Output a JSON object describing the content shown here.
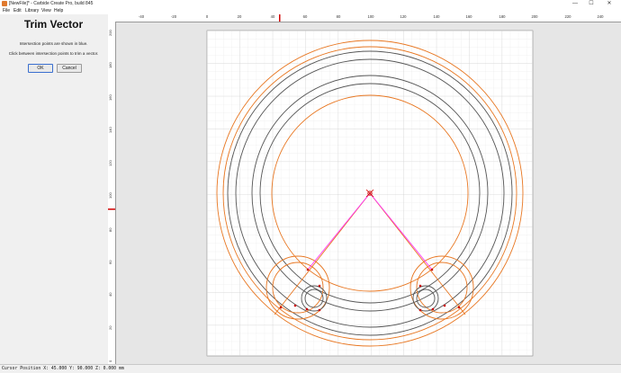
{
  "window": {
    "title": "[NewFile]* - Carbide Create Pro, build 845",
    "minimize_glyph": "—",
    "maximize_glyph": "☐",
    "close_glyph": "✕"
  },
  "menu": {
    "items": [
      "File",
      "Edit",
      "Library",
      "View",
      "Help"
    ]
  },
  "panel": {
    "title": "Trim Vector",
    "line1": "Intersection points are shown in blue.",
    "line2": "Click between intersection points to trim a vector.",
    "ok_label": "OK",
    "cancel_label": "Cancel"
  },
  "ruler": {
    "top_labels": [
      "-40",
      "-20",
      "0",
      "20",
      "40",
      "60",
      "80",
      "100",
      "120",
      "140",
      "160",
      "180",
      "200",
      "220",
      "240"
    ],
    "left_labels": [
      "200",
      "180",
      "160",
      "140",
      "120",
      "100",
      "80",
      "60",
      "40",
      "20",
      "0"
    ]
  },
  "status": {
    "text": "Cursor Position X: 45.000 Y: 90.000 Z: 0.000 mm"
  },
  "colors": {
    "orange": "#e87722",
    "gray_circle": "#555555",
    "magenta": "#ff33ff",
    "marker_red": "#d00000"
  },
  "icons": {
    "app": "carbide-create-icon",
    "ok": "ok-button",
    "cancel": "cancel-button"
  }
}
